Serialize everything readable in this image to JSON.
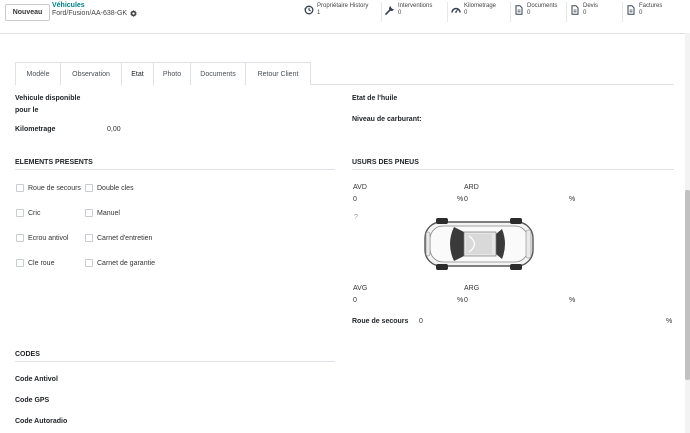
{
  "control_panel": {
    "new_button": "Nouveau",
    "breadcrumb_parent": "Véhicules",
    "breadcrumb_current": "Ford/Fusion/AA-638-GK",
    "stats": [
      {
        "label": "Propriétaire History",
        "value": "1",
        "icon": "history-icon"
      },
      {
        "label": "Interventions",
        "value": "0",
        "icon": "wrench-icon"
      },
      {
        "label": "Kilometrage",
        "value": "0",
        "icon": "gauge-icon"
      },
      {
        "label": "Documents",
        "value": "0",
        "icon": "document-icon"
      },
      {
        "label": "Devis",
        "value": "0",
        "icon": "quote-icon"
      },
      {
        "label": "Factures",
        "value": "0",
        "icon": "invoice-icon"
      }
    ]
  },
  "tabs": [
    "Modèle",
    "Observation",
    "Etat",
    "Photo",
    "Documents",
    "Retour Client"
  ],
  "active_tab": "Etat",
  "left": {
    "vehicule_disponible_l1": "Vehicule disponible",
    "vehicule_disponible_l2": "pour le",
    "kilometrage_label": "Kilometrage",
    "kilometrage_value": "0,00"
  },
  "right": {
    "etat_huile": "Etat de l'huile",
    "niveau_carburant": "Niveau de carburant:"
  },
  "elements_presents": {
    "title": "ELEMENTS PRESENTS",
    "col1": [
      "Roue de secours",
      "Cric",
      "Ecrou antivol",
      "Cle roue"
    ],
    "col2": [
      "Double cles",
      "Manuel",
      "Carnet d'entretien",
      "Carnet de garantie"
    ]
  },
  "usure_pneus": {
    "title": "USURS DES PNEUS",
    "avd_label": "AVD",
    "avd_value": "0",
    "ard_label": "ARD",
    "ard_value": "0",
    "avg_label": "AVG",
    "avg_value": "0",
    "arg_label": "ARG",
    "arg_value": "0",
    "percent": "%",
    "question_mark": "?",
    "roue_secours_label": "Roue de secours",
    "roue_secours_value": "0"
  },
  "codes": {
    "title": "CODES",
    "items": [
      "Code Antivol",
      "Code GPS",
      "Code Autoradio"
    ]
  }
}
